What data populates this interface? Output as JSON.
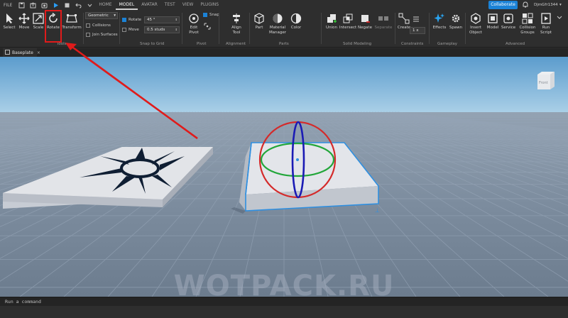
{
  "menubar": {
    "file": "FILE",
    "tabs": [
      {
        "label": "HOME",
        "active": false
      },
      {
        "label": "MODEL",
        "active": true
      },
      {
        "label": "AVATAR",
        "active": false
      },
      {
        "label": "TEST",
        "active": false
      },
      {
        "label": "VIEW",
        "active": false
      },
      {
        "label": "PLUGINS",
        "active": false
      }
    ],
    "collaborate": "Collaborate",
    "username": "DjmGfr1344",
    "user_caret": "▾"
  },
  "ribbon": {
    "tools": {
      "select": "Select",
      "move": "Move",
      "scale": "Scale",
      "rotate": "Rotate",
      "transform": "Transform",
      "group": "Tools"
    },
    "snap": {
      "mode_dropdown": "Geometric",
      "collisions": "Collisions",
      "join_surfaces": "Join Surfaces",
      "rotate_label": "Rotate",
      "rotate_value": "45 °",
      "move_label": "Move",
      "move_value": "0.5 studs",
      "group": "Snap to Grid"
    },
    "pivot": {
      "edit_pivot": "Edit Pivot",
      "snap": "Snap",
      "group": "Pivot"
    },
    "alignment": {
      "align_tool": "Align Tool",
      "group": "Alignment"
    },
    "parts": {
      "part": "Part",
      "material_manager": "Material Manager",
      "color": "Color",
      "group": "Parts"
    },
    "solid_modeling": {
      "union": "Union",
      "intersect": "Intersect",
      "negate": "Negate",
      "separate": "Separate",
      "group": "Solid Modeling"
    },
    "constraints": {
      "create": "Create",
      "value": "1 x",
      "group": "Constraints"
    },
    "gameplay": {
      "effects": "Effects",
      "spawn": "Spawn",
      "group": "Gameplay"
    },
    "advanced": {
      "insert_object": "Insert Object",
      "model": "Model",
      "service": "Service",
      "collision_groups": "Collision Groups",
      "run_script": "Run Script",
      "group": "Advanced"
    }
  },
  "document": {
    "tab_label": "Baseplate",
    "close": "×"
  },
  "viewport": {
    "viewcube_label": "Front",
    "watermark": "WOTPACK.RU"
  },
  "command_bar": {
    "placeholder": "Run a command"
  },
  "colors": {
    "accent": "#1b82d6",
    "highlight": "#e01b1b",
    "sky_top": "#5fa0cf",
    "ground": "#7b8a9c",
    "gizmo_x": "#d22020",
    "gizmo_y": "#1a1ab0",
    "gizmo_z": "#20a030"
  }
}
